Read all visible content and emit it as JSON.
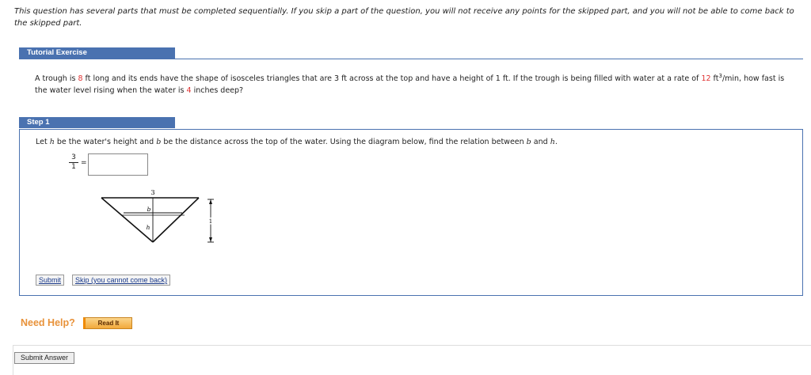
{
  "notice": "This question has several parts that must be completed sequentially. If you skip a part of the question, you will not receive any points for the skipped part, and you will not be able to come back to the skipped part.",
  "tutorial": {
    "tab_label": "Tutorial Exercise",
    "problem_parts": [
      "A trough is ",
      "8",
      " ft long and its ends have the shape of isosceles triangles that are 3 ft across at the top and have a height of 1 ft. If the trough is being filled with water at a rate of ",
      "12",
      " ft",
      "3",
      "/min, how fast is the water level rising when the water is ",
      "4",
      " inches deep?"
    ]
  },
  "step": {
    "tab_label": "Step 1",
    "text_parts": [
      "Let ",
      "h",
      " be the water's height and ",
      "b",
      " be the distance across the top of the water. Using the diagram below, find the relation between ",
      "b",
      " and ",
      "h",
      "."
    ],
    "fraction": {
      "numerator": "3",
      "denominator": "1"
    },
    "equals": "=",
    "answer_value": "",
    "diagram_labels": {
      "top": "3",
      "b": "b",
      "h": "h",
      "height": "1"
    },
    "submit_label": "Submit",
    "skip_label": "Skip (you cannot come back)"
  },
  "help": {
    "need_help": "Need Help?",
    "read_it": "Read It"
  },
  "submit_answer_label": "Submit Answer",
  "colors": {
    "accent_blue": "#4a72b0",
    "highlight_red": "#e03030",
    "help_orange": "#e8923a",
    "button_orange": "#f2a93b"
  }
}
